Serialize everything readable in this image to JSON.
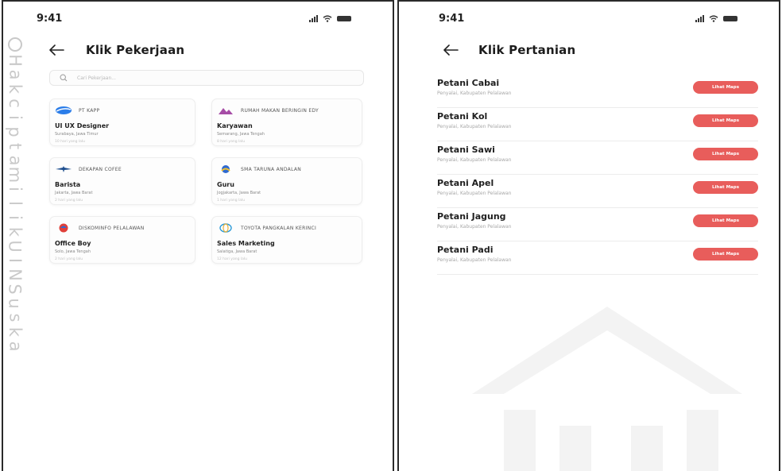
{
  "left_screen": {
    "status_time": "9:41",
    "title": "Klik Pekerjaan",
    "search_placeholder": "Cari Pekerjaan...",
    "watermark_chars": [
      "H",
      "a",
      "k",
      "c",
      "i",
      "p",
      "t",
      "a",
      "m",
      "i",
      "l",
      "i",
      "k",
      "U",
      "I",
      "N",
      "S",
      "u",
      "s",
      "k",
      "a"
    ],
    "cards": [
      {
        "company": "PT KAPP",
        "job": "UI UX Designer",
        "location": "Surabaya, Jawa Timur",
        "posted": "10 hari yang lalu",
        "logo": "blue-wave-icon"
      },
      {
        "company": "RUMAH MAKAN BERINGIN EDY",
        "job": "Karyawan",
        "location": "Semarang, Jawa Tengah",
        "posted": "8 hari yang lalu",
        "logo": "mountain-icon"
      },
      {
        "company": "DEKAPAN COFEE",
        "job": "Barista",
        "location": "Jakarta, Jawa Barat",
        "posted": "2 hari yang lalu",
        "logo": "wings-icon"
      },
      {
        "company": "SMA TARUNA ANDALAN",
        "job": "Guru",
        "location": "Jogjakarta, Jawa Barat",
        "posted": "1 hari yang lalu",
        "logo": "school-icon"
      },
      {
        "company": "DISKOMINFO PELALAWAN",
        "job": "Office Boy",
        "location": "Solo, Jawa Tengah",
        "posted": "2 hari yang lalu",
        "logo": "globe-icon"
      },
      {
        "company": "TOYOTA PANGKALAN KERINCI",
        "job": "Sales Marketing",
        "location": "Salatiga, Jawa Barat",
        "posted": "12 hari yang lalu",
        "logo": "toyota-icon"
      }
    ]
  },
  "right_screen": {
    "status_time": "9:41",
    "title": "Klik Pertanian",
    "button_label": "Lihat Maps",
    "items": [
      {
        "title": "Petani Cabai",
        "subtitle": "Penyalai, Kabupaten Pelalawan"
      },
      {
        "title": "Petani Kol",
        "subtitle": "Penyalai, Kabupaten Pelalawan"
      },
      {
        "title": "Petani Sawi",
        "subtitle": "Penyalai, Kabupaten Pelalawan"
      },
      {
        "title": "Petani Apel",
        "subtitle": "Penyalai, Kabupaten Pelalawan"
      },
      {
        "title": "Petani Jagung",
        "subtitle": "Penyalai, Kabupaten Pelalawan"
      },
      {
        "title": "Petani Padi",
        "subtitle": "Penyalai, Kabupaten Pelalawan"
      }
    ]
  },
  "colors": {
    "accent": "#e85d5b",
    "watermark": "#c9c9c9"
  }
}
